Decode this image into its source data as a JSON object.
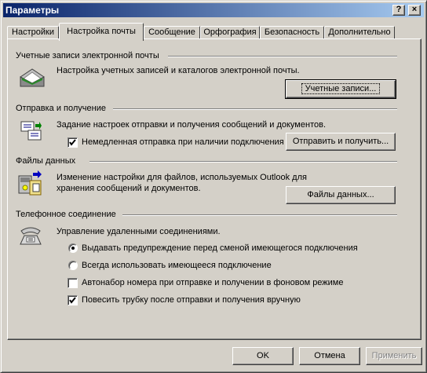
{
  "window": {
    "title": "Параметры",
    "help_button": "?",
    "close_button": "×"
  },
  "tabs": [
    {
      "label": "Настройки",
      "active": false
    },
    {
      "label": "Настройка почты",
      "active": true
    },
    {
      "label": "Сообщение",
      "active": false
    },
    {
      "label": "Орфография",
      "active": false
    },
    {
      "label": "Безопасность",
      "active": false
    },
    {
      "label": "Дополнительно",
      "active": false
    }
  ],
  "accounts": {
    "title": "Учетные записи электронной почты",
    "description": "Настройка учетных записей и каталогов электронной почты.",
    "button": "Учетные записи...",
    "icon": "mail-envelope-icon"
  },
  "send_receive": {
    "title": "Отправка и получение",
    "description": "Задание настроек отправки и получения сообщений и документов.",
    "send_immediately_label": "Немедленная отправка при наличии подключения",
    "send_immediately_checked": true,
    "button": "Отправить и получить...",
    "icon": "send-receive-icon"
  },
  "data_files": {
    "title": "Файлы данных",
    "description_line1": "Изменение настройки для файлов, используемых Outlook для",
    "description_line2": "хранения сообщений и документов.",
    "button": "Файлы данных...",
    "icon": "data-files-icon"
  },
  "dialup": {
    "title": "Телефонное соединение",
    "description": "Управление удаленными соединениями.",
    "radio_warn_label": "Выдавать предупреждение перед сменой имеющегося подключения",
    "radio_warn_selected": true,
    "radio_always_label": "Всегда использовать имеющееся подключение",
    "radio_always_selected": false,
    "autodial_label": "Автонабор номера при отправке и получении в фоновом режиме",
    "autodial_checked": false,
    "hangup_label": "Повесить трубку после отправки и получения вручную",
    "hangup_checked": true,
    "icon": "telephone-icon"
  },
  "footer": {
    "ok": "OK",
    "cancel": "Отмена",
    "apply": "Применить"
  }
}
